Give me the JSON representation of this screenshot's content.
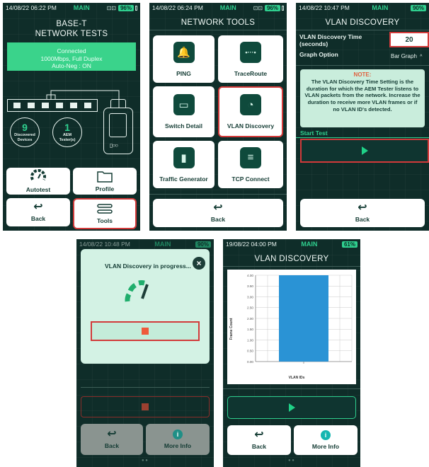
{
  "screen1": {
    "status": {
      "time": "14/08/22 06:22 PM",
      "mode": "MAIN",
      "net": "⊡⊡",
      "battery": "96%"
    },
    "title_line1": "BASE-T",
    "title_line2": "NETWORK TESTS",
    "connection": {
      "line1": "Connected",
      "line2": "1000Mbps, Full Duplex",
      "line3": "Auto-Neg : ON"
    },
    "discovered": {
      "count": "9",
      "label": "Discovered Devices"
    },
    "aem": {
      "count": "1",
      "label": "AEM Tester(s)"
    },
    "buttons": {
      "autotest": "Autotest",
      "profile": "Profile",
      "back": "Back",
      "tools": "Tools"
    }
  },
  "screen2": {
    "status": {
      "time": "14/08/22 06:24 PM",
      "mode": "MAIN",
      "net": "⊡⊡",
      "battery": "96%"
    },
    "title": "NETWORK TOOLS",
    "tools": [
      "PING",
      "TraceRoute",
      "Switch Detail",
      "VLAN Discovery",
      "Traffic Generator",
      "TCP Connect"
    ],
    "back": "Back"
  },
  "screen3": {
    "status": {
      "time": "14/08/22 10:47 PM",
      "mode": "MAIN",
      "battery": "90%"
    },
    "title": "VLAN DISCOVERY",
    "time_label_1": "VLAN Discovery Time",
    "time_label_2": "(seconds)",
    "time_value": "20",
    "graph_label": "Graph Option",
    "graph_value": "Bar Graph",
    "note_title": "NOTE:",
    "note_text": "The VLAN Discovery Time Setting is the duration for which the AEM Tester listens to VLAN packets from the network. Increase the duration to receive more VLAN frames or if no VLAN ID's detected.",
    "start_label": "Start Test",
    "back": "Back"
  },
  "screen4": {
    "status": {
      "time": "14/08/22 10:48 PM",
      "mode": "MAIN",
      "battery": "90%"
    },
    "dialog_title": "VLAN Discovery in progress...",
    "back": "Back",
    "more_info": "More Info"
  },
  "screen5": {
    "status": {
      "time": "19/08/22 04:00 PM",
      "mode": "MAIN",
      "battery": "61%"
    },
    "title": "VLAN DISCOVERY",
    "back": "Back",
    "more_info": "More Info"
  },
  "chart_data": {
    "type": "bar",
    "categories": [
      ""
    ],
    "values": [
      4.0
    ],
    "xlabel": "VLAN IDs",
    "ylabel": "Frame Count",
    "ylim": [
      0,
      4
    ],
    "yticks": [
      "4.00",
      "3.50",
      "3.00",
      "2.50",
      "2.00",
      "1.50",
      "1.00",
      "0.50",
      "0.00"
    ],
    "bar_color": "#2a93d5",
    "grid": true
  },
  "colors": {
    "accent_green": "#2fd08f",
    "bg": "#0f2d29",
    "selection": "#d23a3a"
  }
}
